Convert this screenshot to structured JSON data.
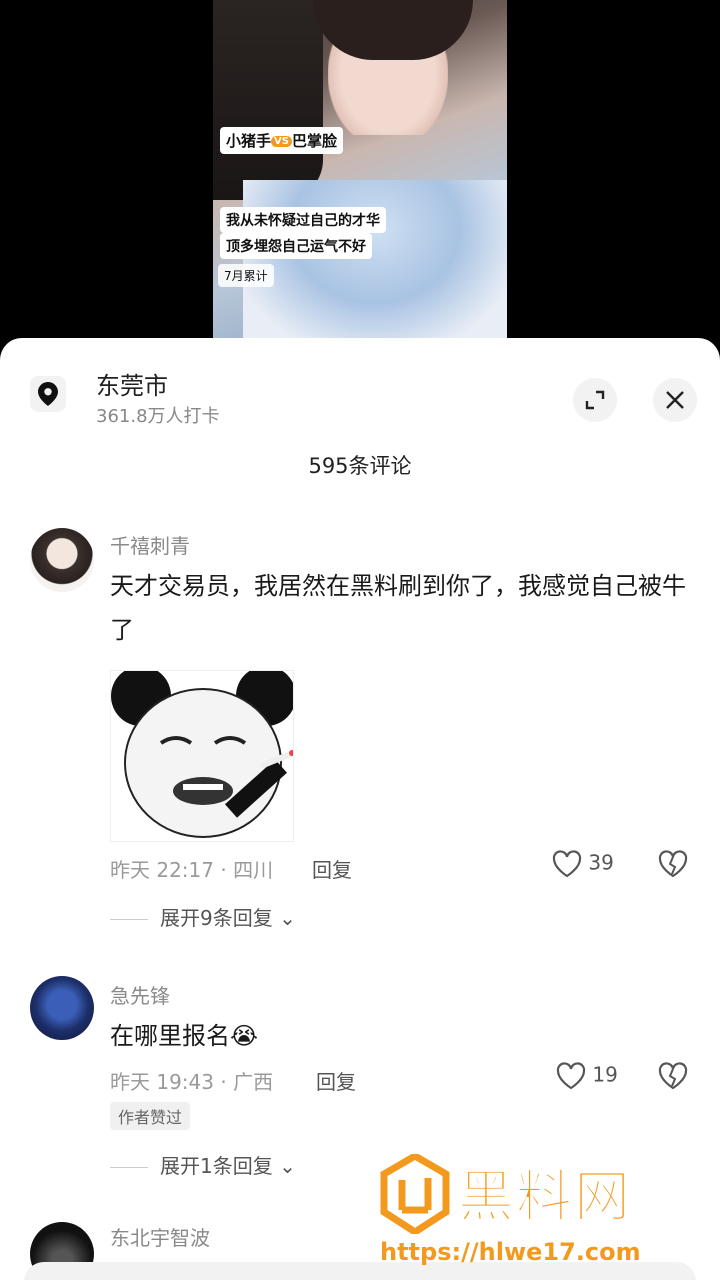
{
  "video": {
    "tag1_left": "小猪手",
    "tag1_vs": "VS",
    "tag1_right": "巴掌脸",
    "line1": "我从未怀疑过自己的才华",
    "line2": "顶多埋怨自己运气不好",
    "line3": "7月累计"
  },
  "location": {
    "name": "东莞市",
    "checkins": "361.8万人打卡"
  },
  "comments_header": "595条评论",
  "comments": [
    {
      "author": "千禧刺青",
      "text": "天才交易员，我居然在黑料刷到你了，我感觉自己被牛了",
      "meta": "昨天 22:17 · 四川",
      "reply_label": "回复",
      "likes": "39",
      "expand": "展开9条回复"
    },
    {
      "author": "急先锋",
      "text": "在哪里报名😭",
      "meta": "昨天 19:43 · 广西",
      "reply_label": "回复",
      "likes": "19",
      "badge": "作者赞过",
      "expand": "展开1条回复"
    },
    {
      "author": "东北宇智波"
    }
  ],
  "watermark": {
    "title": "黑料网",
    "url": "https://hlwe17.com"
  },
  "colors": {
    "accent": "#f39a1e",
    "muted": "#8a8a8a"
  }
}
